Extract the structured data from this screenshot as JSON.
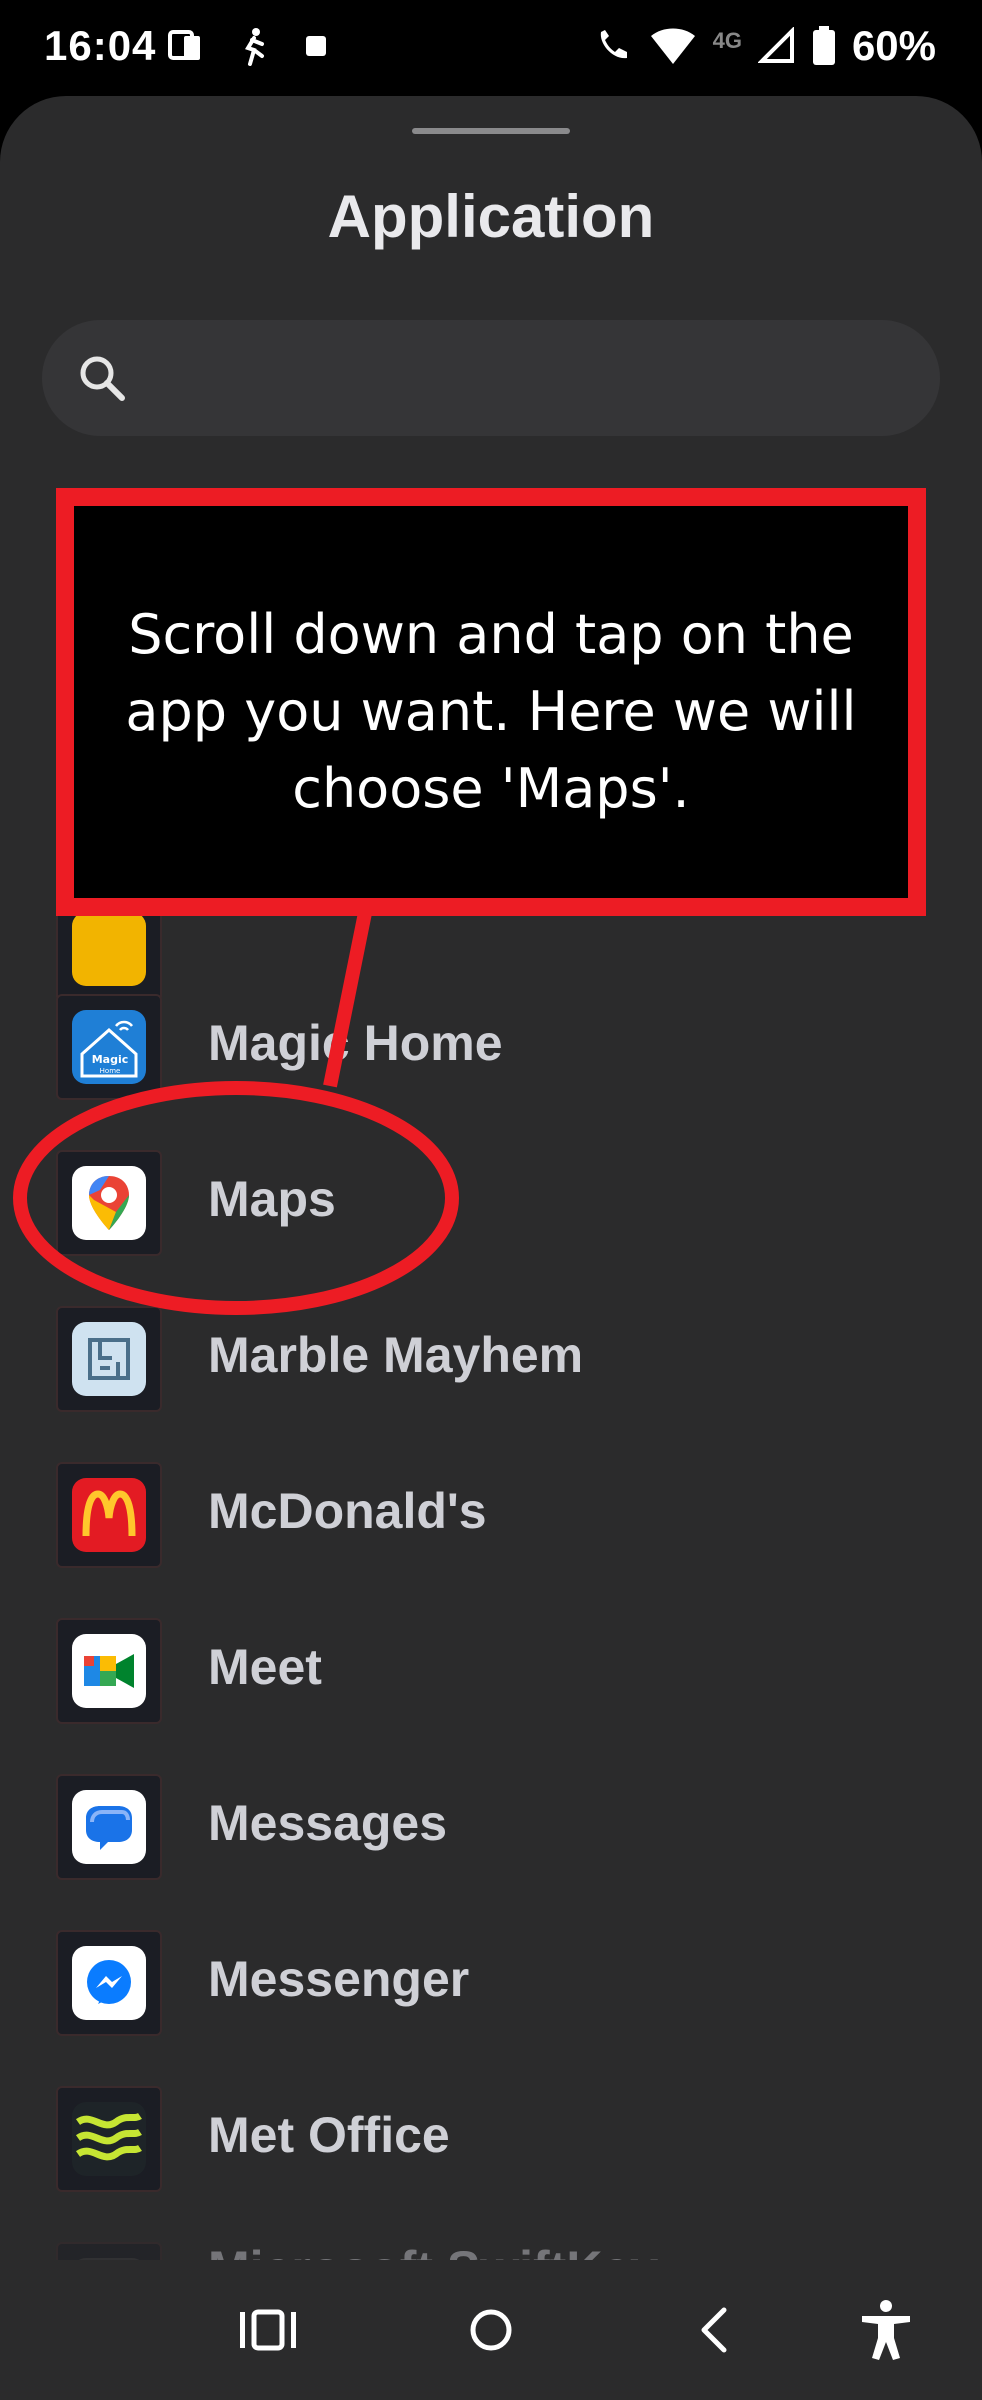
{
  "status_bar": {
    "time": "16:04",
    "network_label": "4G",
    "battery": "60%"
  },
  "sheet": {
    "title": "Application",
    "search": {
      "placeholder": "",
      "value": ""
    }
  },
  "apps": [
    {
      "label": "Magic Home",
      "icon": "magic-home-icon",
      "color": "#1f7fd6"
    },
    {
      "label": "Maps",
      "icon": "maps-pin-icon",
      "color": "#ffffff"
    },
    {
      "label": "Marble Mayhem",
      "icon": "maze-icon",
      "color": "#cfe2f0"
    },
    {
      "label": "McDonald's",
      "icon": "mcdonalds-arches-icon",
      "color": "#e31b23"
    },
    {
      "label": "Meet",
      "icon": "meet-camera-icon",
      "color": "#ffffff"
    },
    {
      "label": "Messages",
      "icon": "messages-bubble-icon",
      "color": "#ffffff"
    },
    {
      "label": "Messenger",
      "icon": "messenger-icon",
      "color": "#ffffff"
    },
    {
      "label": "Met Office",
      "icon": "met-office-waves-icon",
      "color": "#1e2428"
    },
    {
      "label": "Microsoft SwiftKey",
      "icon": "swiftkey-icon",
      "color": "#3a3a3d"
    }
  ],
  "tutorial": {
    "callout_text": "Scroll down and tap on the app you want. Here we will choose 'Maps'.",
    "highlight_color": "#ed1c24"
  },
  "colors": {
    "sheet_background": "#2b2b2c",
    "search_background": "#353537",
    "label_text": "#cfd0d6"
  }
}
